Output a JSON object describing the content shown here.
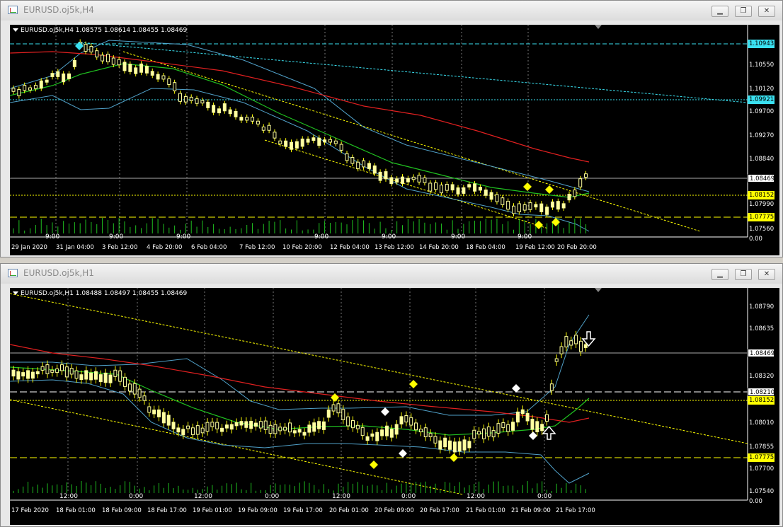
{
  "windows": [
    {
      "title": "EURUSD.oj5k,H4",
      "info": "EURUSD.oj5k,H4  1.08575 1.08614 1.08455 1.08469",
      "price_levels": [
        "1.10943",
        "1.10550",
        "1.10120",
        "1.09921",
        "1.09700",
        "1.09270",
        "1.08840",
        "1.08469",
        "1.08152",
        "1.07990",
        "1.07775",
        "1.07560",
        "0.00"
      ],
      "mid_labels": [
        "9:00",
        "9:00",
        "9:00",
        "9:00",
        "9:00",
        "9:00",
        "9:00"
      ],
      "date_labels": [
        "29 Jan 2020",
        "31 Jan 04:00",
        "3 Feb 12:00",
        "4 Feb 20:00",
        "6 Feb 04:00",
        "7 Feb 12:00",
        "10 Feb 20:00",
        "12 Feb 04:00",
        "13 Feb 12:00",
        "14 Feb 20:00",
        "18 Feb 04:00",
        "19 Feb 12:00",
        "20 Feb 20:00"
      ],
      "colors": {
        "ma_red": "#e02020",
        "ma_green": "#20c020",
        "bands": "#50a0c8",
        "highlight_cyan": "#3ae0f0",
        "level_yellow": "#ffff00"
      }
    },
    {
      "title": "EURUSD.oj5k,H1",
      "info": "EURUSD.oj5k,H1  1.08488 1.08497 1.08455 1.08469",
      "price_levels": [
        "1.08790",
        "1.08635",
        "1.08469",
        "1.08320",
        "1.08210",
        "1.08152",
        "1.08010",
        "1.07855",
        "1.07775",
        "1.07700",
        "1.07540",
        "0.00"
      ],
      "mid_labels": [
        "12:00",
        "0:00",
        "12:00",
        "0:00",
        "12:00",
        "0:00",
        "12:00",
        "0:00"
      ],
      "date_labels": [
        "17 Feb 2020",
        "18 Feb 01:00",
        "18 Feb 09:00",
        "18 Feb 17:00",
        "19 Feb 01:00",
        "19 Feb 09:00",
        "19 Feb 17:00",
        "20 Feb 01:00",
        "20 Feb 09:00",
        "20 Feb 17:00",
        "21 Feb 01:00",
        "21 Feb 09:00",
        "21 Feb 17:00"
      ],
      "colors": {
        "ma_red": "#e02020",
        "ma_green": "#20c020",
        "bands": "#50a0c8",
        "level_yellow": "#ffff00"
      }
    }
  ]
}
